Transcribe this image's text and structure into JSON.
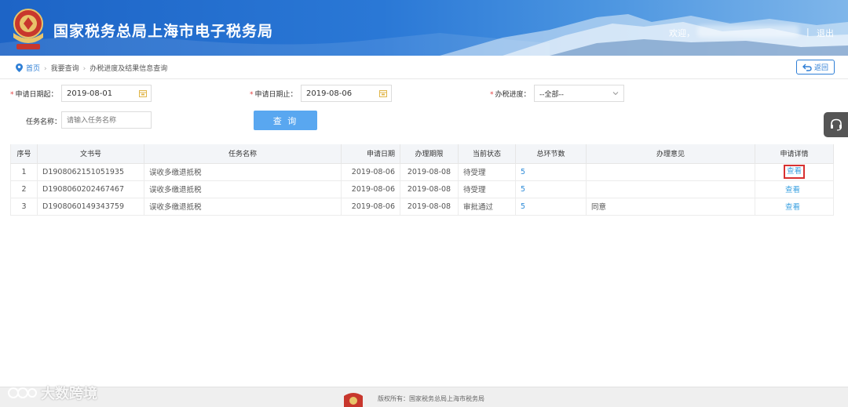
{
  "header": {
    "title": "国家税务总局上海市电子税务局",
    "welcome": "欢迎，",
    "separator": "|",
    "logout": "退出"
  },
  "breadcrumb": {
    "home": "首页",
    "level1": "我要查询",
    "level2": "办税进度及结果信息查询",
    "back_label": "返回"
  },
  "form": {
    "date_start_label": "申请日期起：",
    "date_start_value": "2019-08-01",
    "date_end_label": "申请日期止：",
    "date_end_value": "2019-08-06",
    "progress_label": "办税进度：",
    "progress_value": "--全部--",
    "task_label": "任务名称：",
    "task_placeholder": "请输入任务名称",
    "query_button": "查 询",
    "required_mark": "*"
  },
  "table": {
    "columns": [
      "序号",
      "文书号",
      "任务名称",
      "申请日期",
      "办理期限",
      "当前状态",
      "总环节数",
      "办理意见",
      "申请详情"
    ],
    "rows": [
      {
        "no": "1",
        "doc": "D1908062151051935",
        "task": "误收多缴退抵税",
        "apply_date": "2019-08-06",
        "deadline": "2019-08-08",
        "status": "待受理",
        "steps": "5",
        "opinion": "",
        "detail": "查看"
      },
      {
        "no": "2",
        "doc": "D1908060202467467",
        "task": "误收多缴退抵税",
        "apply_date": "2019-08-06",
        "deadline": "2019-08-08",
        "status": "待受理",
        "steps": "5",
        "opinion": "",
        "detail": "查看"
      },
      {
        "no": "3",
        "doc": "D1908060149343759",
        "task": "误收多缴退抵税",
        "apply_date": "2019-08-06",
        "deadline": "2019-08-08",
        "status": "审批通过",
        "steps": "5",
        "opinion": "同意",
        "detail": "查看"
      }
    ]
  },
  "footer": {
    "copyright": "版权所有：国家税务总局上海市税务局"
  },
  "watermark": {
    "text": "大数跨境"
  },
  "colors": {
    "header_blue": "#1d64c6",
    "link_blue": "#2e8bd8",
    "button_blue": "#59a7f0",
    "required_red": "#e24040",
    "highlight_red": "#d83030"
  }
}
